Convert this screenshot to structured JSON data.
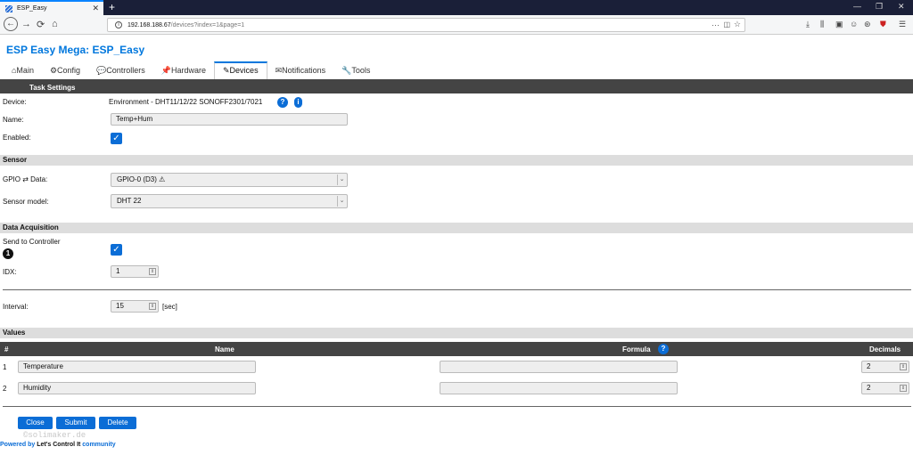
{
  "browser": {
    "tab_title": "ESP_Easy",
    "url_host": "192.168.188.67",
    "url_path": "/devices?index=1&page=1"
  },
  "app": {
    "title": "ESP Easy Mega: ESP_Easy"
  },
  "menu": [
    {
      "label": "⌂Main"
    },
    {
      "label": "⚙Config"
    },
    {
      "label": "💬Controllers"
    },
    {
      "label": "📌Hardware"
    },
    {
      "label": "✎Devices",
      "active": true
    },
    {
      "label": "✉Notifications"
    },
    {
      "label": "🔧Tools"
    }
  ],
  "task": {
    "header": "Task Settings",
    "device_label": "Device:",
    "device_value": "Environment - DHT11/12/22 SONOFF2301/7021",
    "name_label": "Name:",
    "name_value": "Temp+Hum",
    "enabled_label": "Enabled:"
  },
  "sensor": {
    "header": "Sensor",
    "gpio_label": "GPIO ⇄ Data:",
    "gpio_value": "GPIO-0 (D3) ⚠",
    "model_label": "Sensor model:",
    "model_value": "DHT 22"
  },
  "acq": {
    "header": "Data Acquisition",
    "send_label": "Send to Controller",
    "controller_num": "1",
    "idx_label": "IDX:",
    "idx_value": "1",
    "interval_label": "Interval:",
    "interval_value": "15",
    "interval_unit": "[sec]"
  },
  "values": {
    "header": "Values",
    "columns": {
      "num": "#",
      "name": "Name",
      "formula": "Formula",
      "decimals": "Decimals"
    },
    "rows": [
      {
        "num": "1",
        "name": "Temperature",
        "formula": "",
        "decimals": "2"
      },
      {
        "num": "2",
        "name": "Humidity",
        "formula": "",
        "decimals": "2"
      }
    ]
  },
  "buttons": {
    "close": "Close",
    "submit": "Submit",
    "delete": "Delete"
  },
  "watermark": "©solimaker.de",
  "footer": {
    "prefix": "Powered by ",
    "brand": "Let's Control It",
    "suffix": " community"
  },
  "colors": {
    "accent": "#0b6dd6",
    "header_bar": "#444444",
    "section_bg": "#dddddd"
  }
}
